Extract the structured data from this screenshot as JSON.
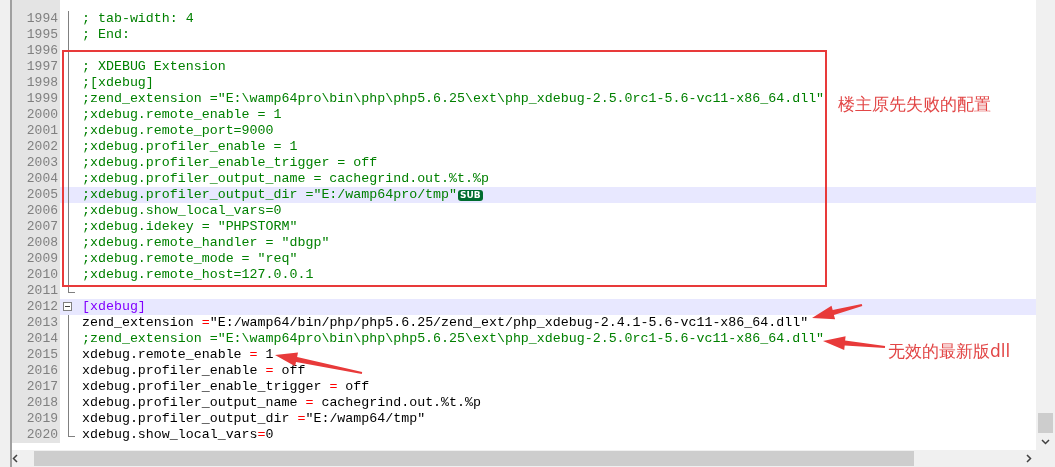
{
  "editor": {
    "lines": [
      {
        "number": "1994",
        "kind": "fold-body",
        "highlighted": false,
        "segments": [
          {
            "kind": "comment",
            "text": "; tab-width: 4"
          }
        ]
      },
      {
        "number": "1995",
        "kind": "fold-body",
        "highlighted": false,
        "segments": [
          {
            "kind": "comment",
            "text": "; End:"
          }
        ]
      },
      {
        "number": "1996",
        "kind": "fold-body",
        "highlighted": false
      },
      {
        "number": "1997",
        "kind": "fold-body",
        "highlighted": false,
        "segments": [
          {
            "kind": "comment",
            "text": "; XDEBUG Extension"
          }
        ]
      },
      {
        "number": "1998",
        "kind": "fold-body",
        "highlighted": false,
        "segments": [
          {
            "kind": "comment",
            "text": ";[xdebug]"
          }
        ]
      },
      {
        "number": "1999",
        "kind": "fold-body",
        "highlighted": false,
        "segments": [
          {
            "kind": "comment",
            "text": ";zend_extension =\"E:\\wamp64pro\\bin\\php\\php5.6.25\\ext\\php_xdebug-2.5.0rc1-5.6-vc11-x86_64.dll\""
          }
        ]
      },
      {
        "number": "2000",
        "kind": "fold-body",
        "highlighted": false,
        "segments": [
          {
            "kind": "comment",
            "text": ";xdebug.remote_enable = 1"
          }
        ]
      },
      {
        "number": "2001",
        "kind": "fold-body",
        "highlighted": false,
        "segments": [
          {
            "kind": "comment",
            "text": ";xdebug.remote_port=9000"
          }
        ]
      },
      {
        "number": "2002",
        "kind": "fold-body",
        "highlighted": false,
        "segments": [
          {
            "kind": "comment",
            "text": ";xdebug.profiler_enable = 1"
          }
        ]
      },
      {
        "number": "2003",
        "kind": "fold-body",
        "highlighted": false,
        "segments": [
          {
            "kind": "comment",
            "text": ";xdebug.profiler_enable_trigger = off"
          }
        ]
      },
      {
        "number": "2004",
        "kind": "fold-body",
        "highlighted": false,
        "segments": [
          {
            "kind": "comment",
            "text": ";xdebug.profiler_output_name = cachegrind.out.%t.%p"
          }
        ]
      },
      {
        "number": "2005",
        "kind": "fold-body",
        "highlighted": true,
        "segments": [
          {
            "kind": "comment",
            "text": ";xdebug.profiler_output_dir =\"E:/wamp64pro/tmp\""
          }
        ],
        "badge": "SUB"
      },
      {
        "number": "2006",
        "kind": "fold-body",
        "highlighted": false,
        "segments": [
          {
            "kind": "comment",
            "text": ";xdebug.show_local_vars=0"
          }
        ]
      },
      {
        "number": "2007",
        "kind": "fold-body",
        "highlighted": false,
        "segments": [
          {
            "kind": "comment",
            "text": ";xdebug.idekey = \"PHPSTORM\""
          }
        ]
      },
      {
        "number": "2008",
        "kind": "fold-body",
        "highlighted": false,
        "segments": [
          {
            "kind": "comment",
            "text": ";xdebug.remote_handler = \"dbgp\""
          }
        ]
      },
      {
        "number": "2009",
        "kind": "fold-body",
        "highlighted": false,
        "segments": [
          {
            "kind": "comment",
            "text": ";xdebug.remote_mode = \"req\""
          }
        ]
      },
      {
        "number": "2010",
        "kind": "fold-body",
        "highlighted": false,
        "segments": [
          {
            "kind": "comment",
            "text": ";xdebug.remote_host=127.0.0.1"
          }
        ]
      },
      {
        "number": "2011",
        "kind": "fold-end",
        "highlighted": false
      },
      {
        "number": "2012",
        "kind": "fold-start",
        "highlighted": true,
        "segments": [
          {
            "kind": "section",
            "text": "[xdebug]"
          }
        ]
      },
      {
        "number": "2013",
        "kind": "fold-body",
        "highlighted": false,
        "segments": [
          {
            "kind": "key",
            "text": "zend_extension "
          },
          {
            "kind": "op",
            "text": "="
          },
          {
            "kind": "value",
            "text": "\"E:/wamp64/bin/php/php5.6.25/zend_ext/php_xdebug-2.4.1-5.6-vc11-x86_64.dll\""
          }
        ]
      },
      {
        "number": "2014",
        "kind": "fold-body",
        "highlighted": false,
        "segments": [
          {
            "kind": "comment",
            "text": ";zend_extension =\"E:\\wamp64pro\\bin\\php\\php5.6.25\\ext\\php_xdebug-2.5.0rc1-5.6-vc11-x86_64.dll\""
          }
        ]
      },
      {
        "number": "2015",
        "kind": "fold-body",
        "highlighted": false,
        "segments": [
          {
            "kind": "key",
            "text": "xdebug.remote_enable "
          },
          {
            "kind": "op",
            "text": "="
          },
          {
            "kind": "value",
            "text": " 1"
          }
        ]
      },
      {
        "number": "2016",
        "kind": "fold-body",
        "highlighted": false,
        "segments": [
          {
            "kind": "key",
            "text": "xdebug.profiler_enable "
          },
          {
            "kind": "op",
            "text": "="
          },
          {
            "kind": "value",
            "text": " off"
          }
        ]
      },
      {
        "number": "2017",
        "kind": "fold-body",
        "highlighted": false,
        "segments": [
          {
            "kind": "key",
            "text": "xdebug.profiler_enable_trigger "
          },
          {
            "kind": "op",
            "text": "="
          },
          {
            "kind": "value",
            "text": " off"
          }
        ]
      },
      {
        "number": "2018",
        "kind": "fold-body",
        "highlighted": false,
        "segments": [
          {
            "kind": "key",
            "text": "xdebug.profiler_output_name "
          },
          {
            "kind": "op",
            "text": "="
          },
          {
            "kind": "value",
            "text": " cachegrind.out.%t.%p"
          }
        ]
      },
      {
        "number": "2019",
        "kind": "fold-body",
        "highlighted": false,
        "segments": [
          {
            "kind": "key",
            "text": "xdebug.profiler_output_dir "
          },
          {
            "kind": "op",
            "text": "="
          },
          {
            "kind": "value",
            "text": "\"E:/wamp64/tmp\""
          }
        ]
      },
      {
        "number": "2020",
        "kind": "fold-end",
        "highlighted": false,
        "segments": [
          {
            "kind": "key",
            "text": "xdebug.show_local_vars"
          },
          {
            "kind": "op",
            "text": "="
          },
          {
            "kind": "value",
            "text": "0"
          }
        ]
      }
    ]
  },
  "annotations": [
    {
      "kind": "box-label",
      "text": "楼主原先失败的配置"
    },
    {
      "kind": "arrow-label",
      "text": "无效的最新版dll"
    }
  ]
}
